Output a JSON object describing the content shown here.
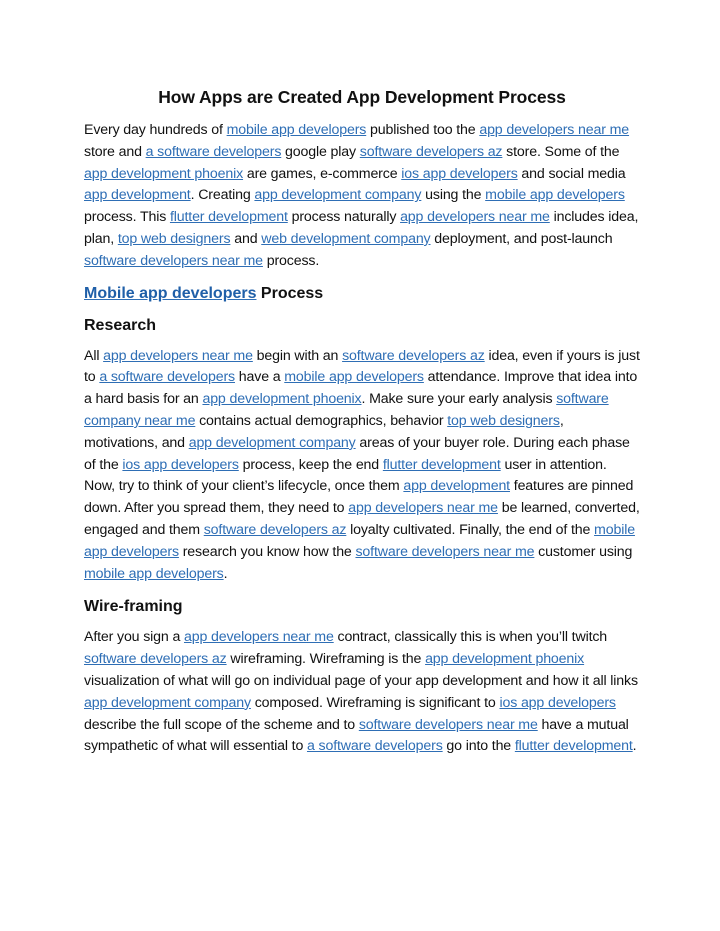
{
  "document": {
    "title": "How Apps are Created App Development Process",
    "link_color": "#2e6eb5",
    "intro": [
      {
        "t": "Every day hundreds of "
      },
      {
        "t": "mobile app developers",
        "link": true
      },
      {
        "t": " published too the "
      },
      {
        "t": "app developers near me",
        "link": true
      },
      {
        "t": " store and "
      },
      {
        "t": "a software developers",
        "link": true
      },
      {
        "t": " google play "
      },
      {
        "t": "software developers az",
        "link": true
      },
      {
        "t": " store. Some of the "
      },
      {
        "t": "app development phoenix",
        "link": true
      },
      {
        "t": " are games, e-commerce "
      },
      {
        "t": "ios app developers",
        "link": true
      },
      {
        "t": " and social media "
      },
      {
        "t": "app development",
        "link": true
      },
      {
        "t": ". Creating "
      },
      {
        "t": "app development company",
        "link": true
      },
      {
        "t": " using the "
      },
      {
        "t": "mobile app developers",
        "link": true
      },
      {
        "t": " process. This "
      },
      {
        "t": "flutter development",
        "link": true
      },
      {
        "t": " process naturally "
      },
      {
        "t": "app developers near me",
        "link": true
      },
      {
        "t": " includes idea, plan, "
      },
      {
        "t": "top web designers",
        "link": true
      },
      {
        "t": " and "
      },
      {
        "t": "web development company",
        "link": true
      },
      {
        "t": " deployment, and post-launch "
      },
      {
        "t": "software developers near me",
        "link": true
      },
      {
        "t": " process."
      }
    ],
    "process_heading": {
      "link_text": "Mobile app developers",
      "rest": " Process"
    },
    "research_heading": "Research",
    "research": [
      {
        "t": "All "
      },
      {
        "t": "app developers near me",
        "link": true
      },
      {
        "t": " begin with an "
      },
      {
        "t": "software developers az",
        "link": true
      },
      {
        "t": " idea, even if yours is just to "
      },
      {
        "t": "a software developers",
        "link": true
      },
      {
        "t": " have a "
      },
      {
        "t": "mobile app developers",
        "link": true
      },
      {
        "t": " attendance. Improve that idea into a hard basis for an "
      },
      {
        "t": "app development phoenix",
        "link": true
      },
      {
        "t": ". Make sure your early analysis "
      },
      {
        "t": "software company near me",
        "link": true
      },
      {
        "t": " contains actual demographics, behavior "
      },
      {
        "t": "top web designers",
        "link": true
      },
      {
        "t": ", motivations, and "
      },
      {
        "t": "app development company",
        "link": true
      },
      {
        "t": " areas of your buyer role. During each phase of the "
      },
      {
        "t": "ios app developers",
        "link": true
      },
      {
        "t": " process, keep the end "
      },
      {
        "t": "flutter development",
        "link": true
      },
      {
        "t": " user in attention. Now, try to think of your client’s lifecycle, once them "
      },
      {
        "t": "app development",
        "link": true
      },
      {
        "t": " features are pinned down. After you spread them, they need to "
      },
      {
        "t": "app developers near me",
        "link": true
      },
      {
        "t": " be learned, converted, engaged and them "
      },
      {
        "t": "software developers az",
        "link": true
      },
      {
        "t": " loyalty cultivated. Finally, the end of the "
      },
      {
        "t": "mobile app developers",
        "link": true
      },
      {
        "t": " research you know how the "
      },
      {
        "t": "software developers near me",
        "link": true
      },
      {
        "t": " customer using "
      },
      {
        "t": "mobile app developers",
        "link": true
      },
      {
        "t": "."
      }
    ],
    "wireframe_heading": "Wire-framing",
    "wireframe": [
      {
        "t": "After you sign a "
      },
      {
        "t": "app developers near me",
        "link": true
      },
      {
        "t": " contract, classically this is when you’ll twitch "
      },
      {
        "t": "software developers az",
        "link": true
      },
      {
        "t": " wireframing. Wireframing is the "
      },
      {
        "t": "app development phoenix",
        "link": true
      },
      {
        "t": " visualization of what will go on individual page of your app development and how it all links "
      },
      {
        "t": "app development company",
        "link": true
      },
      {
        "t": " composed. Wireframing is significant to "
      },
      {
        "t": "ios app developers",
        "link": true
      },
      {
        "t": " describe the full scope of the scheme and to "
      },
      {
        "t": "software developers near me",
        "link": true
      },
      {
        "t": " have a mutual sympathetic of what will essential to "
      },
      {
        "t": "a software developers",
        "link": true
      },
      {
        "t": " go into the "
      },
      {
        "t": "flutter development",
        "link": true
      },
      {
        "t": "."
      }
    ]
  }
}
